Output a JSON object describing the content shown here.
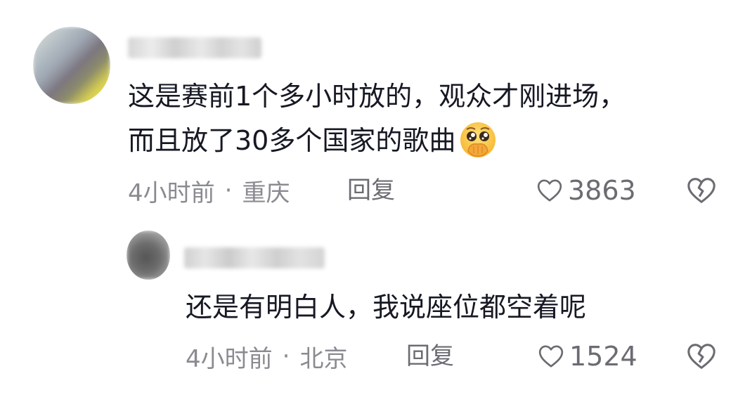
{
  "comments": [
    {
      "line1": "这是赛前1个多小时放的，观众才刚进场，",
      "line2": "而且放了30多个国家的歌曲",
      "emoji": "pleading-hands-over-mouth-emoji",
      "time": "4小时前",
      "separator": "·",
      "location": "重庆",
      "reply_label": "回复",
      "likes": "3863"
    }
  ],
  "reply": {
    "text": "还是有明白人，我说座位都空着呢",
    "time": "4小时前",
    "separator": "·",
    "location": "北京",
    "reply_label": "回复",
    "likes": "1524"
  },
  "icons": {
    "like": "heart-outline-icon",
    "dislike": "broken-heart-icon"
  },
  "colors": {
    "text": "#161823",
    "meta": "#8a8b91",
    "icon": "#6b6c72"
  }
}
